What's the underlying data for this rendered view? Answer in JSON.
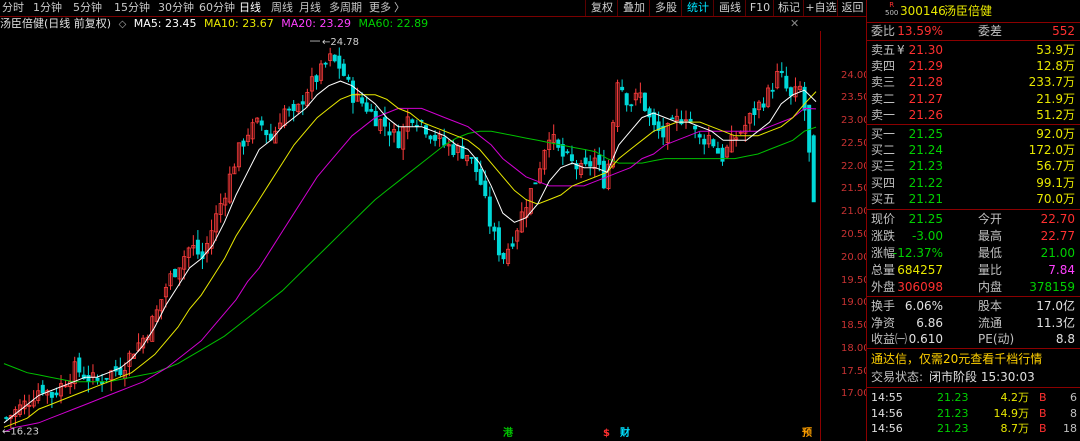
{
  "toolbar": {
    "periods": [
      "分时",
      "1分钟",
      "5分钟",
      "15分钟",
      "30分钟",
      "60分钟",
      "日线",
      "周线",
      "月线",
      "多周期",
      "更多"
    ],
    "active": "日线",
    "more_arrow": "〉",
    "right_buttons": [
      "复权",
      "叠加",
      "多股",
      "统计",
      "画线",
      "F10",
      "标记",
      "+自选",
      "返回"
    ],
    "highlight_button": "统计"
  },
  "legend": {
    "title": "汤臣倍健(日线 前复权)",
    "ma5": "MA5: 23.45",
    "ma10": "MA10: 23.67",
    "ma20": "MA20: 23.29",
    "ma60": "MA60: 22.89",
    "dropdown_arrow": "◇",
    "close_glyph": "✕"
  },
  "chart_data": {
    "type": "candlestick",
    "title": "",
    "y_ticks": [
      "24.00",
      "23.50",
      "23.00",
      "22.50",
      "22.00",
      "21.50",
      "21.00",
      "20.50",
      "20.00",
      "19.50",
      "19.00",
      "18.50",
      "18.00",
      "17.50",
      "17.00"
    ],
    "ylim": [
      16.0,
      25.0
    ],
    "high_label": "24.78",
    "low_label": "16.23",
    "markers": [
      {
        "text": "港",
        "color": "#00c000"
      },
      {
        "text": "$",
        "color": "#ff3030"
      },
      {
        "text": "财",
        "color": "#00e0ff"
      },
      {
        "text": "预",
        "color": "#ffa000"
      }
    ],
    "close_path": [
      16.5,
      16.7,
      16.9,
      17.2,
      17.0,
      17.3,
      17.6,
      17.4,
      17.3,
      17.5,
      17.6,
      18.0,
      18.3,
      18.8,
      19.5,
      19.9,
      20.3,
      20.0,
      20.8,
      21.5,
      22.3,
      22.8,
      23.0,
      22.6,
      23.3,
      23.1,
      23.7,
      24.0,
      24.4,
      24.2,
      23.6,
      23.4,
      23.1,
      22.9,
      22.6,
      23.2,
      23.0,
      22.7,
      22.5,
      22.4,
      22.3,
      21.8,
      20.7,
      20.0,
      20.5,
      21.2,
      21.8,
      22.8,
      22.3,
      22.1,
      21.9,
      22.2,
      21.6,
      24.0,
      23.4,
      23.6,
      22.9,
      22.7,
      23.0,
      23.2,
      22.6,
      22.7,
      22.2,
      22.6,
      22.9,
      23.3,
      23.6,
      24.1,
      23.5,
      23.8,
      21.25
    ],
    "ma5": [
      16.4,
      16.6,
      16.8,
      17.0,
      17.1,
      17.2,
      17.3,
      17.4,
      17.4,
      17.5,
      17.6,
      17.8,
      18.1,
      18.5,
      19.0,
      19.4,
      19.8,
      20.0,
      20.3,
      20.8,
      21.4,
      21.9,
      22.4,
      22.6,
      22.9,
      23.1,
      23.3,
      23.6,
      23.8,
      23.9,
      23.8,
      23.6,
      23.4,
      23.1,
      22.9,
      22.9,
      22.9,
      22.8,
      22.7,
      22.5,
      22.4,
      22.1,
      21.6,
      21.0,
      20.8,
      20.9,
      21.2,
      21.7,
      22.0,
      22.1,
      22.0,
      22.0,
      21.9,
      22.5,
      22.8,
      23.1,
      23.2,
      23.1,
      23.0,
      23.0,
      22.9,
      22.8,
      22.6,
      22.6,
      22.6,
      22.8,
      23.0,
      23.4,
      23.6,
      23.7,
      23.45
    ],
    "ma10": [
      16.3,
      16.4,
      16.5,
      16.7,
      16.8,
      16.9,
      17.0,
      17.1,
      17.2,
      17.3,
      17.4,
      17.5,
      17.7,
      17.9,
      18.2,
      18.5,
      18.9,
      19.2,
      19.6,
      20.0,
      20.5,
      20.9,
      21.3,
      21.7,
      22.1,
      22.5,
      22.8,
      23.1,
      23.3,
      23.5,
      23.6,
      23.6,
      23.6,
      23.5,
      23.3,
      23.2,
      23.0,
      22.9,
      22.8,
      22.7,
      22.6,
      22.4,
      22.1,
      21.8,
      21.5,
      21.3,
      21.2,
      21.3,
      21.4,
      21.6,
      21.7,
      21.8,
      21.9,
      22.2,
      22.4,
      22.6,
      22.8,
      22.9,
      23.0,
      23.0,
      23.0,
      22.9,
      22.8,
      22.7,
      22.7,
      22.7,
      22.8,
      22.9,
      23.1,
      23.4,
      23.67
    ],
    "ma20": [
      16.2,
      16.3,
      16.35,
      16.4,
      16.5,
      16.6,
      16.7,
      16.8,
      16.9,
      17.0,
      17.1,
      17.2,
      17.3,
      17.45,
      17.6,
      17.8,
      18.0,
      18.2,
      18.5,
      18.8,
      19.1,
      19.5,
      19.8,
      20.2,
      20.6,
      21.0,
      21.4,
      21.8,
      22.1,
      22.4,
      22.7,
      22.9,
      23.1,
      23.2,
      23.3,
      23.3,
      23.3,
      23.2,
      23.1,
      23.0,
      22.9,
      22.7,
      22.5,
      22.2,
      22.0,
      21.8,
      21.7,
      21.6,
      21.6,
      21.6,
      21.6,
      21.7,
      21.8,
      21.9,
      22.0,
      22.2,
      22.3,
      22.5,
      22.6,
      22.7,
      22.8,
      22.8,
      22.8,
      22.8,
      22.8,
      22.8,
      22.9,
      23.0,
      23.1,
      23.3,
      23.29
    ],
    "ma60": [
      17.7,
      17.6,
      17.5,
      17.45,
      17.4,
      17.35,
      17.3,
      17.3,
      17.3,
      17.3,
      17.35,
      17.4,
      17.45,
      17.5,
      17.6,
      17.7,
      17.85,
      18.0,
      18.15,
      18.3,
      18.5,
      18.7,
      18.9,
      19.1,
      19.3,
      19.55,
      19.8,
      20.05,
      20.3,
      20.55,
      20.8,
      21.05,
      21.3,
      21.5,
      21.7,
      21.9,
      22.1,
      22.3,
      22.5,
      22.65,
      22.75,
      22.8,
      22.8,
      22.75,
      22.7,
      22.65,
      22.6,
      22.55,
      22.5,
      22.45,
      22.4,
      22.35,
      22.2,
      22.1,
      22.1,
      22.1,
      22.15,
      22.2,
      22.2,
      22.2,
      22.2,
      22.2,
      22.2,
      22.2,
      22.25,
      22.3,
      22.4,
      22.5,
      22.6,
      22.8,
      22.89
    ]
  },
  "panel": {
    "code_badge_top": "R",
    "code_badge_bottom": "500",
    "code": "300146",
    "name": "汤臣倍健",
    "wb_label": "委比",
    "wb_value": "13.59%",
    "wc_label": "委差",
    "wc_value": "552",
    "sells": [
      {
        "label": "卖五",
        "mark": "¥",
        "price": "21.30",
        "vol": "53.9万"
      },
      {
        "label": "卖四",
        "mark": "",
        "price": "21.29",
        "vol": "12.8万"
      },
      {
        "label": "卖三",
        "mark": "",
        "price": "21.28",
        "vol": "233.7万"
      },
      {
        "label": "卖二",
        "mark": "",
        "price": "21.27",
        "vol": "21.9万"
      },
      {
        "label": "卖一",
        "mark": "",
        "price": "21.26",
        "vol": "51.2万"
      }
    ],
    "buys": [
      {
        "label": "买一",
        "price": "21.25",
        "vol": "92.0万"
      },
      {
        "label": "买二",
        "price": "21.24",
        "vol": "172.0万"
      },
      {
        "label": "买三",
        "price": "21.23",
        "vol": "56.7万"
      },
      {
        "label": "买四",
        "price": "21.22",
        "vol": "99.1万"
      },
      {
        "label": "买五",
        "price": "21.21",
        "vol": "70.0万"
      }
    ],
    "quote": [
      {
        "l1": "现价",
        "v1": "21.25",
        "c1": "green",
        "l2": "今开",
        "v2": "22.70",
        "c2": "red"
      },
      {
        "l1": "涨跌",
        "v1": "-3.00",
        "c1": "green",
        "l2": "最高",
        "v2": "22.77",
        "c2": "red"
      },
      {
        "l1": "涨幅",
        "v1": "-12.37%",
        "c1": "green",
        "l2": "最低",
        "v2": "21.00",
        "c2": "green"
      },
      {
        "l1": "总量",
        "v1": "684257",
        "c1": "yellow",
        "l2": "量比",
        "v2": "7.84",
        "c2": "mag"
      },
      {
        "l1": "外盘",
        "v1": "306098",
        "c1": "red",
        "l2": "内盘",
        "v2": "378159",
        "c2": "green"
      }
    ],
    "stats": [
      {
        "l1": "换手",
        "v1": "6.06%",
        "l2": "股本",
        "v2": "17.0亿"
      },
      {
        "l1": "净资",
        "v1": "6.86",
        "l2": "流通",
        "v2": "11.3亿"
      },
      {
        "l1": "收益㈠",
        "v1": "0.610",
        "l2": "PE(动)",
        "v2": "8.8"
      }
    ],
    "ad_text": "通达信，仅需20元查看千档行情",
    "status_label": "交易状态:",
    "status_value": "闭市阶段 15:30:03",
    "trades": [
      {
        "time": "14:55",
        "price": "21.23",
        "vol": "4.2万",
        "dir": "B",
        "n": "6"
      },
      {
        "time": "14:56",
        "price": "21.23",
        "vol": "14.9万",
        "dir": "B",
        "n": "8"
      },
      {
        "time": "14:56",
        "price": "21.23",
        "vol": "8.7万",
        "dir": "B",
        "n": "18"
      }
    ]
  }
}
